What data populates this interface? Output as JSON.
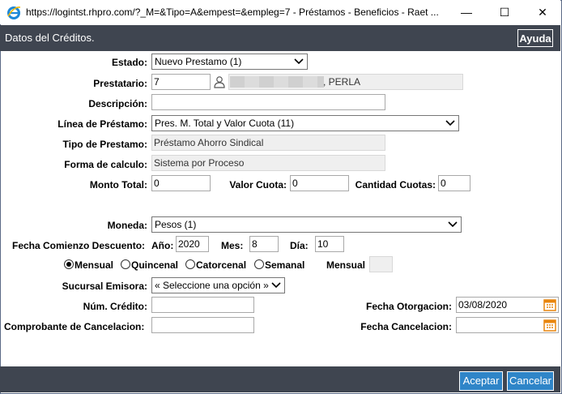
{
  "window": {
    "title": "https://logintst.rhpro.com/?_M=&Tipo=A&empest=&empleg=7 - Préstamos - Beneficios - Raet ...",
    "minimize": "—",
    "maximize": "☐",
    "close": "✕"
  },
  "header": {
    "title": "Datos del Créditos.",
    "help_label": "Ayuda"
  },
  "form": {
    "estado": {
      "label": "Estado:",
      "value": "Nuevo Prestamo (1)"
    },
    "prestatario": {
      "label": "Prestatario:",
      "code": "7",
      "name": ", PERLA"
    },
    "descripcion": {
      "label": "Descripción:",
      "value": ""
    },
    "linea": {
      "label": "Línea de Préstamo:",
      "value": "Pres. M. Total y Valor Cuota (11)"
    },
    "tipo": {
      "label": "Tipo de Prestamo:",
      "value": "Préstamo Ahorro Sindical"
    },
    "forma": {
      "label": "Forma de calculo:",
      "value": "Sistema por Proceso"
    },
    "monto_total": {
      "label": "Monto Total:",
      "value": "0"
    },
    "valor_cuota": {
      "label": "Valor Cuota:",
      "value": "0"
    },
    "cantidad_cuotas": {
      "label": "Cantidad Cuotas:",
      "value": "0"
    },
    "moneda": {
      "label": "Moneda:",
      "value": "Pesos (1)"
    },
    "fecha_comienzo": {
      "label": "Fecha Comienzo Descuento:",
      "anio_label": "Año:",
      "anio": "2020",
      "mes_label": "Mes:",
      "mes": "8",
      "dia_label": "Día:",
      "dia": "10"
    },
    "periodicidad": {
      "options": [
        "Mensual",
        "Quincenal",
        "Catorcenal",
        "Semanal"
      ],
      "selected": "Mensual",
      "mensual_label": "Mensual",
      "mensual_value": ""
    },
    "sucursal": {
      "label": "Sucursal Emisora:",
      "value": "« Seleccione una opción »"
    },
    "num_credito": {
      "label": "Núm. Crédito:",
      "value": ""
    },
    "fecha_otorgacion": {
      "label": "Fecha Otorgacion:",
      "value": "03/08/2020"
    },
    "comprobante": {
      "label": "Comprobante de Cancelacion:",
      "value": ""
    },
    "fecha_cancelacion": {
      "label": "Fecha Cancelacion:",
      "value": ""
    }
  },
  "footer": {
    "accept_label": "Aceptar",
    "cancel_label": "Cancelar"
  },
  "colors": {
    "header_bg": "#3f4550",
    "button_bg": "#2f85c8",
    "calendar": "#e8860f"
  },
  "icons": [
    "ie-icon",
    "user-icon",
    "chevron-down-icon",
    "calendar-icon"
  ]
}
